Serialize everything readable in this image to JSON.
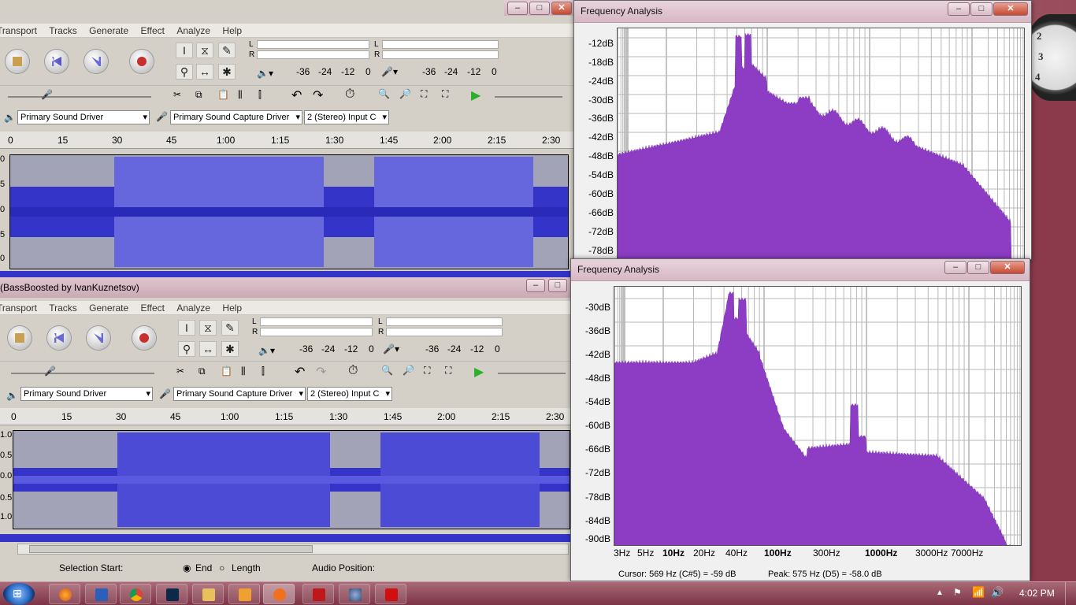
{
  "desktop": {
    "clock_numerals": [
      "2",
      "3",
      "4"
    ]
  },
  "audacity_top": {
    "menu": [
      "Transport",
      "Tracks",
      "Generate",
      "Effect",
      "Analyze",
      "Help"
    ],
    "meter_labels": {
      "play_l": "L",
      "play_r": "R",
      "rec_l": "L",
      "rec_r": "R"
    },
    "meter_ticks": [
      "-36",
      "-24",
      "-12",
      "0"
    ],
    "output_device": "Primary Sound Driver",
    "input_device": "Primary Sound Capture Driver",
    "channels": "2 (Stereo) Input C",
    "timeline": [
      "0",
      "15",
      "30",
      "45",
      "1:00",
      "1:15",
      "1:30",
      "1:45",
      "2:00",
      "2:15",
      "2:30"
    ],
    "amp_labels": [
      "0",
      "5",
      "0",
      "5",
      "0"
    ]
  },
  "audacity_bottom": {
    "title": "(BassBoosted by IvanKuznetsov)",
    "menu": [
      "Transport",
      "Tracks",
      "Generate",
      "Effect",
      "Analyze",
      "Help"
    ],
    "meter_labels": {
      "play_l": "L",
      "play_r": "R",
      "rec_l": "L",
      "rec_r": "R"
    },
    "meter_ticks": [
      "-36",
      "-24",
      "-12",
      "0"
    ],
    "output_device": "Primary Sound Driver",
    "input_device": "Primary Sound Capture Driver",
    "channels": "2 (Stereo) Input C",
    "timeline": [
      "0",
      "15",
      "30",
      "45",
      "1:00",
      "1:15",
      "1:30",
      "1:45",
      "2:00",
      "2:15",
      "2:30"
    ],
    "amp_labels": [
      "1.0",
      "0.5",
      "0.0",
      "0.5",
      "1.0"
    ],
    "selection_start": "Selection Start:",
    "end_label": "End",
    "length_label": "Length",
    "audio_position": "Audio Position:"
  },
  "freq_top": {
    "title": "Frequency Analysis",
    "y_ticks": [
      "-12dB",
      "-18dB",
      "-24dB",
      "-30dB",
      "-36dB",
      "-42dB",
      "-48dB",
      "-54dB",
      "-60dB",
      "-66dB",
      "-72dB",
      "-78dB"
    ],
    "fill_color": "#8d3cc4"
  },
  "freq_bottom": {
    "title": "Frequency Analysis",
    "y_ticks": [
      "-30dB",
      "-36dB",
      "-42dB",
      "-48dB",
      "-54dB",
      "-60dB",
      "-66dB",
      "-72dB",
      "-78dB",
      "-84dB",
      "-90dB"
    ],
    "x_ticks": [
      "3Hz",
      "5Hz",
      "10Hz",
      "20Hz",
      "40Hz",
      "100Hz",
      "300Hz",
      "1000Hz",
      "3000Hz",
      "7000Hz"
    ],
    "cursor_readout": "Cursor: 569 Hz (C#5) = -59 dB",
    "peak_readout": "Peak: 575 Hz (D5) = -58.0 dB",
    "fill_color": "#8d3cc4"
  },
  "window_buttons": {
    "minimize": "–",
    "maximize": "□",
    "close": "✕"
  },
  "taskbar": {
    "clock": "4:02 PM",
    "apps": [
      "firefox",
      "word",
      "chrome",
      "photoshop",
      "explorer",
      "media-player",
      "audacity",
      "mcafee",
      "network-tool",
      "acrobat"
    ]
  }
}
